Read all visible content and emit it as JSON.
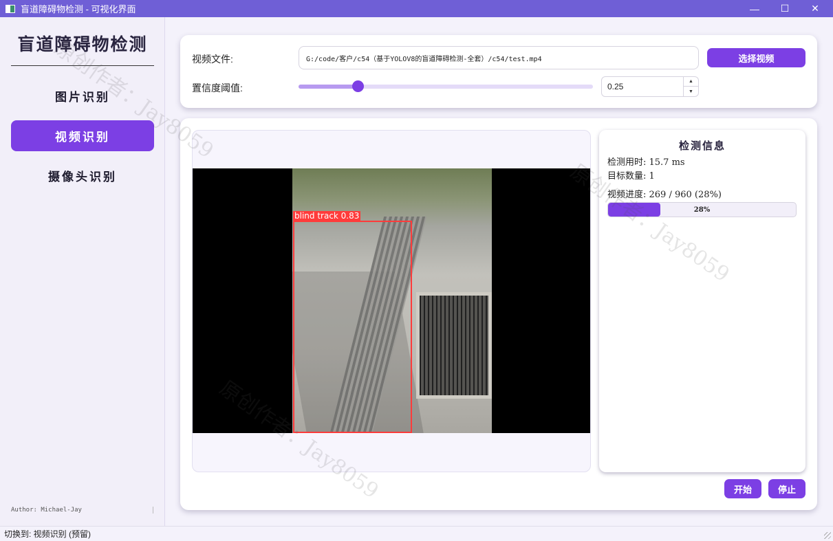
{
  "window": {
    "title": "盲道障碍物检测 - 可视化界面",
    "controls": {
      "minimize": "—",
      "maximize": "☐",
      "close": "✕"
    }
  },
  "sidebar": {
    "title": "盲道障碍物检测",
    "items": [
      {
        "label": "图片识别",
        "active": false
      },
      {
        "label": "视频识别",
        "active": true
      },
      {
        "label": "摄像头识别",
        "active": false
      }
    ],
    "author": "Author: Michael-Jay"
  },
  "controls": {
    "video_file_label": "视频文件:",
    "video_path": "G:/code/客户/c54（基于YOLOV8的盲道障碍检测-全套）/c54/test.mp4",
    "select_button": "选择视频",
    "threshold_label": "置信度阈值:",
    "threshold_value": "0.25",
    "threshold_level": 0.2
  },
  "detection": {
    "label": "blind track 0.83"
  },
  "info": {
    "title": "检测信息",
    "time": "检测用时: 15.7 ms",
    "count": "目标数量: 1",
    "progress_text": "视频进度: 269 / 960 (28%)",
    "progress_label": "28%",
    "progress_value": 0.28
  },
  "actions": {
    "start": "开始",
    "stop": "停止"
  },
  "watermark": "原创作者：Jay8059",
  "status": "切换到: 视频识别 (预留)",
  "colors": {
    "accent": "#7c3fe4",
    "titlebar": "#6f5fd6",
    "detection_box": "#ff3b3b"
  }
}
